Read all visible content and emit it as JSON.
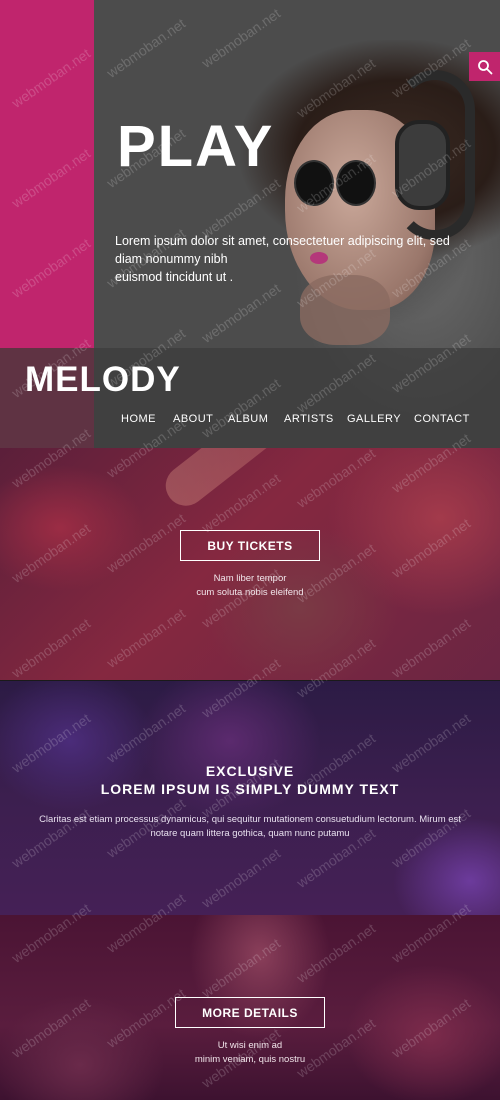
{
  "hero": {
    "title": "PLAY",
    "text_line1": "Lorem ipsum dolor sit amet, consectetuer adipiscing elit, sed",
    "text_line2": "diam nonummy nibh",
    "text_line3": "euismod tincidunt ut ."
  },
  "brand": "MELODY",
  "nav": [
    "HOME",
    "ABOUT",
    "ALBUM",
    "ARTISTS",
    "GALLERY",
    "CONTACT"
  ],
  "tickets": {
    "button": "BUY TICKETS",
    "line1": "Nam liber tempor",
    "line2": "cum soluta nobis eleifend"
  },
  "exclusive": {
    "heading1": "EXCLUSIVE",
    "heading2": "LOREM IPSUM IS SIMPLY DUMMY TEXT",
    "line1": "Claritas est etiam processus dynamicus, qui sequitur mutationem consuetudium lectorum. Mirum est",
    "line2": "notare quam littera gothica, quam nunc putamu"
  },
  "details": {
    "button": "MORE DETAILS",
    "line1": "Ut wisi enim ad",
    "line2": "minim veniam, quis nostru"
  },
  "watermark": "webmoban.net",
  "icons": {
    "search": "search-icon"
  },
  "colors": {
    "accent": "#c0256d"
  }
}
